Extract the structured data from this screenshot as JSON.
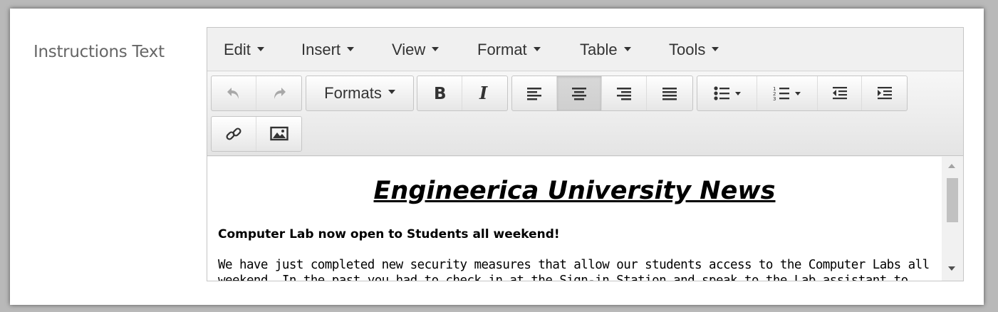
{
  "field": {
    "label": "Instructions Text"
  },
  "menubar": {
    "items": [
      {
        "label": "Edit"
      },
      {
        "label": "Insert"
      },
      {
        "label": "View"
      },
      {
        "label": "Format"
      },
      {
        "label": "Table"
      },
      {
        "label": "Tools"
      }
    ]
  },
  "toolbar": {
    "formats_label": "Formats",
    "buttons": [
      "undo-icon",
      "redo-icon",
      "formats-dropdown",
      "bold-icon",
      "italic-icon",
      "align-left-icon",
      "align-center-icon",
      "align-right-icon",
      "align-justify-icon",
      "bullet-list-icon",
      "numbered-list-icon",
      "outdent-icon",
      "indent-icon",
      "link-icon",
      "image-icon"
    ],
    "active_button": "align-center-icon"
  },
  "content": {
    "title": "Engineerica University News",
    "heading": "Computer Lab now open to Students all weekend!",
    "paragraph": "We have just completed new security measures that allow our students access to the Computer Labs all weekend. In the past you had to check in at the Sign-in Station and speak to the Lab assistant to"
  },
  "colors": {
    "label_text": "#666666",
    "toolbar_bg": "#f0f0f0",
    "border": "#c5c5c5"
  }
}
